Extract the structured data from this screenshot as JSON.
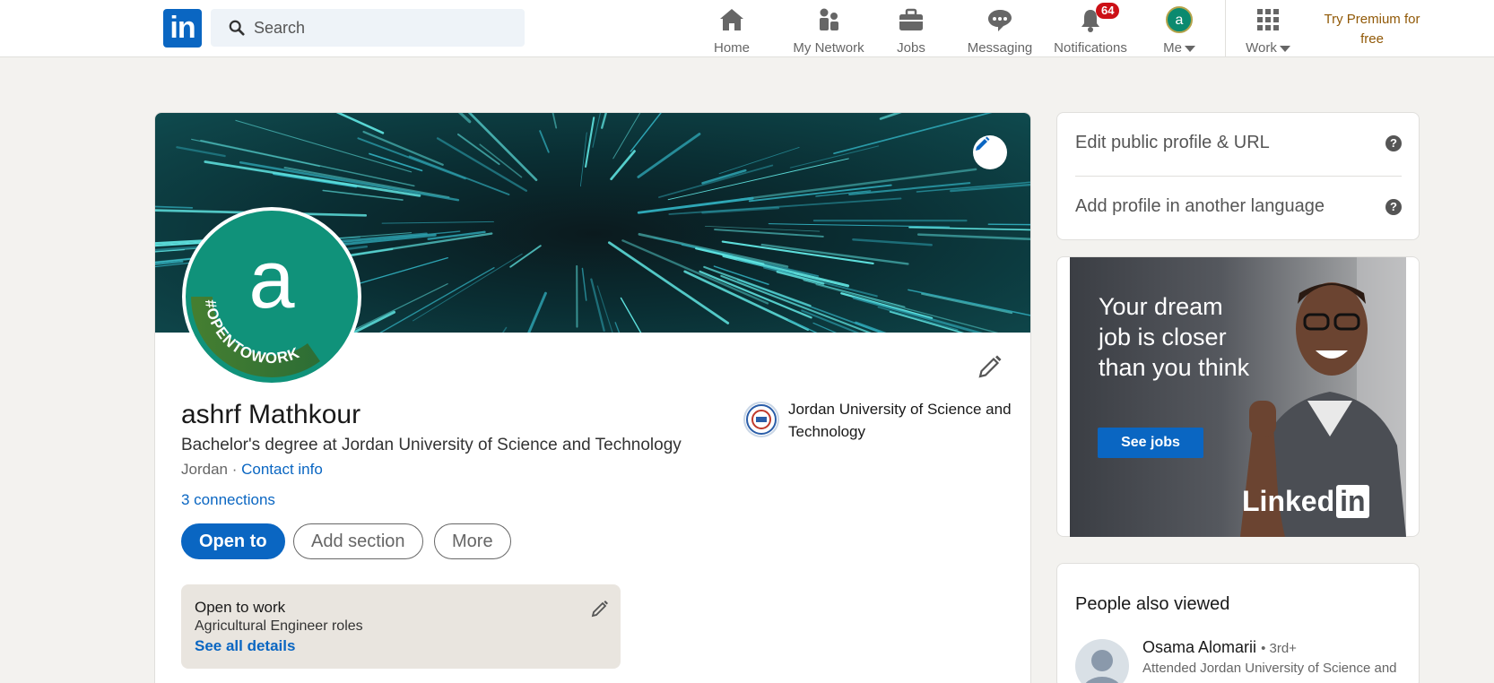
{
  "nav": {
    "logo": "in",
    "search_placeholder": "Search",
    "items": [
      {
        "label": "Home",
        "icon": "home-icon"
      },
      {
        "label": "My Network",
        "icon": "network-icon"
      },
      {
        "label": "Jobs",
        "icon": "briefcase-icon"
      },
      {
        "label": "Messaging",
        "icon": "chat-icon"
      },
      {
        "label": "Notifications",
        "icon": "bell-icon",
        "badge": "64"
      },
      {
        "label": "Me",
        "icon": "avatar",
        "avatar_letter": "a"
      },
      {
        "label": "Work",
        "icon": "grid-icon"
      }
    ],
    "premium": "Try Premium for free",
    "colors": {
      "brand": "#0a66c2",
      "badge": "#cc1016",
      "premium": "#915907"
    }
  },
  "profile": {
    "avatar_letter": "a",
    "frame_text": "#OPENTOWORK",
    "name": "ashrf Mathkour",
    "headline": "Bachelor's degree at Jordan University of Science and Technology",
    "location": "Jordan",
    "location_sep": " · ",
    "contact_info": "Contact info",
    "connections": "3 connections",
    "buttons": {
      "open_to": "Open to",
      "add_section": "Add section",
      "more": "More"
    },
    "school": "Jordan University of Science and Technology",
    "open_to_work": {
      "title": "Open to work",
      "roles": "Agricultural Engineer roles",
      "details_link": "See all details"
    }
  },
  "sidebar": {
    "edit_public_profile": "Edit public profile & URL",
    "add_language": "Add profile in another language",
    "help_glyph": "?"
  },
  "ad": {
    "headline": "Your dream job is closer than you think",
    "cta": "See jobs",
    "brand_text": "Linked",
    "brand_in": "in"
  },
  "people_also_viewed": {
    "title": "People also viewed",
    "people": [
      {
        "name": "Osama Alomarii",
        "degree": "• 3rd+",
        "headline": "Attended Jordan University of Science and"
      }
    ]
  }
}
